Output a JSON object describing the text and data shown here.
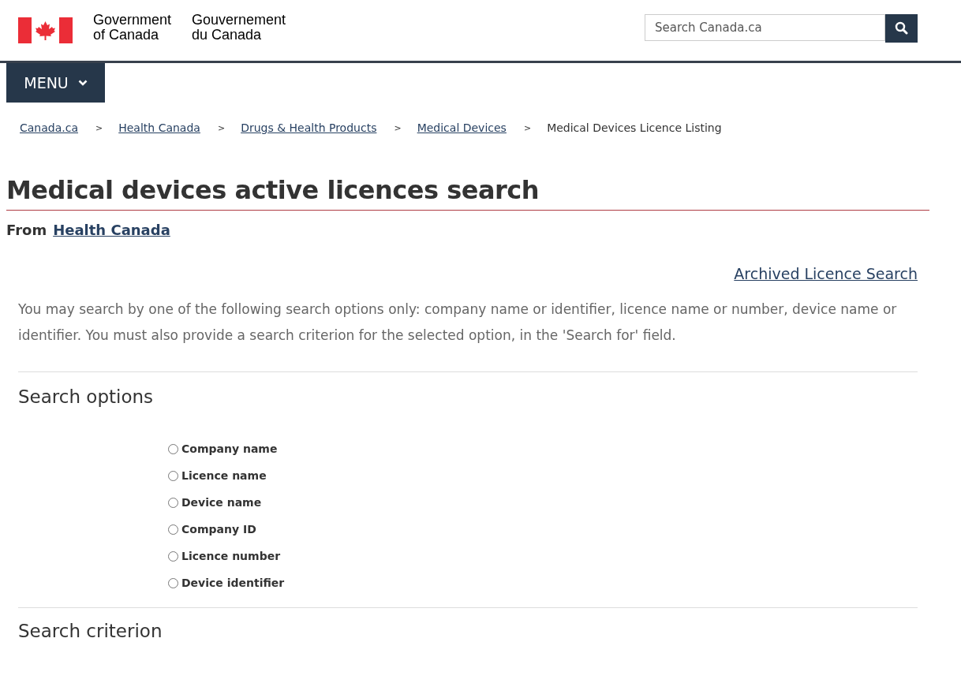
{
  "header": {
    "brand_en": [
      "Government",
      "of Canada"
    ],
    "brand_fr": [
      "Gouvernement",
      "du Canada"
    ],
    "search": {
      "placeholder": "Search Canada.ca"
    }
  },
  "menu": {
    "label": "MENU"
  },
  "breadcrumbs": [
    {
      "label": "Canada.ca",
      "link": true
    },
    {
      "label": "Health Canada",
      "link": true
    },
    {
      "label": "Drugs & Health Products",
      "link": true
    },
    {
      "label": "Medical Devices",
      "link": true
    },
    {
      "label": "Medical Devices Licence Listing",
      "link": false
    }
  ],
  "breadcrumb_separator": ">",
  "title": "Medical devices active licences search",
  "from": {
    "label": "From",
    "link": "Health Canada"
  },
  "archived_link": "Archived Licence Search",
  "intro": "You may search by one of the following search options only: company name or identifier, licence name or number, device name or identifier. You must also provide a search criterion for the selected option, in the 'Search for' field.",
  "search_options": {
    "heading": "Search options",
    "options": [
      {
        "label": "Company name",
        "selected": false
      },
      {
        "label": "Licence name",
        "selected": false
      },
      {
        "label": "Device name",
        "selected": false
      },
      {
        "label": "Company ID",
        "selected": false
      },
      {
        "label": "Licence number",
        "selected": false
      },
      {
        "label": "Device identifier",
        "selected": false
      }
    ]
  },
  "search_criterion": {
    "heading": "Search criterion"
  }
}
